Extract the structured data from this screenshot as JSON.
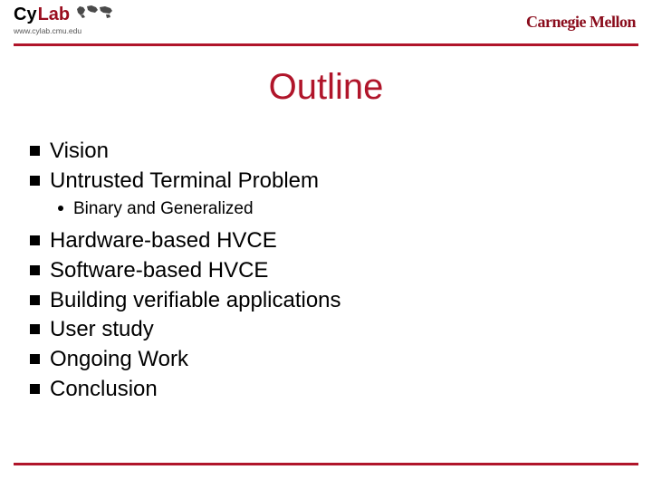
{
  "header": {
    "logo_cy": "Cy",
    "logo_lab": "Lab",
    "logo_url": "www.cylab.cmu.edu",
    "cmu": "Carnegie Mellon"
  },
  "title": "Outline",
  "bullets": {
    "b0": "Vision",
    "b1": "Untrusted Terminal Problem",
    "b1s0": "Binary and Generalized",
    "b2": "Hardware-based HVCE",
    "b3": "Software-based HVCE",
    "b4": "Building verifiable applications",
    "b5": "User study",
    "b6": "Ongoing Work",
    "b7": "Conclusion"
  }
}
